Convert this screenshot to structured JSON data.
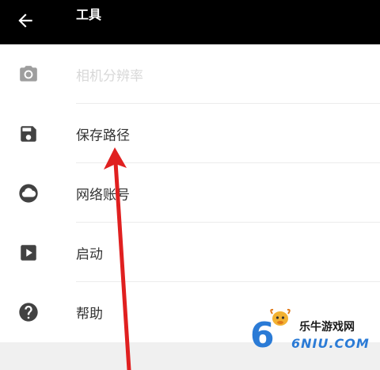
{
  "appbar": {
    "title": "工具",
    "back_icon": "arrow-left-icon",
    "background": "#000000"
  },
  "menu": [
    {
      "label": "相机分辨率",
      "icon": "camera-icon",
      "disabled": true
    },
    {
      "label": "保存路径",
      "icon": "save-icon",
      "disabled": false
    },
    {
      "label": "网络账号",
      "icon": "cloud-icon",
      "disabled": false
    },
    {
      "label": "启动",
      "icon": "play-icon",
      "disabled": false
    },
    {
      "label": "帮助",
      "icon": "help-icon",
      "disabled": false
    }
  ],
  "annotation": {
    "color": "#e02020"
  },
  "watermark": {
    "cn": "乐牛游戏网",
    "en": "6NIU.COM"
  }
}
